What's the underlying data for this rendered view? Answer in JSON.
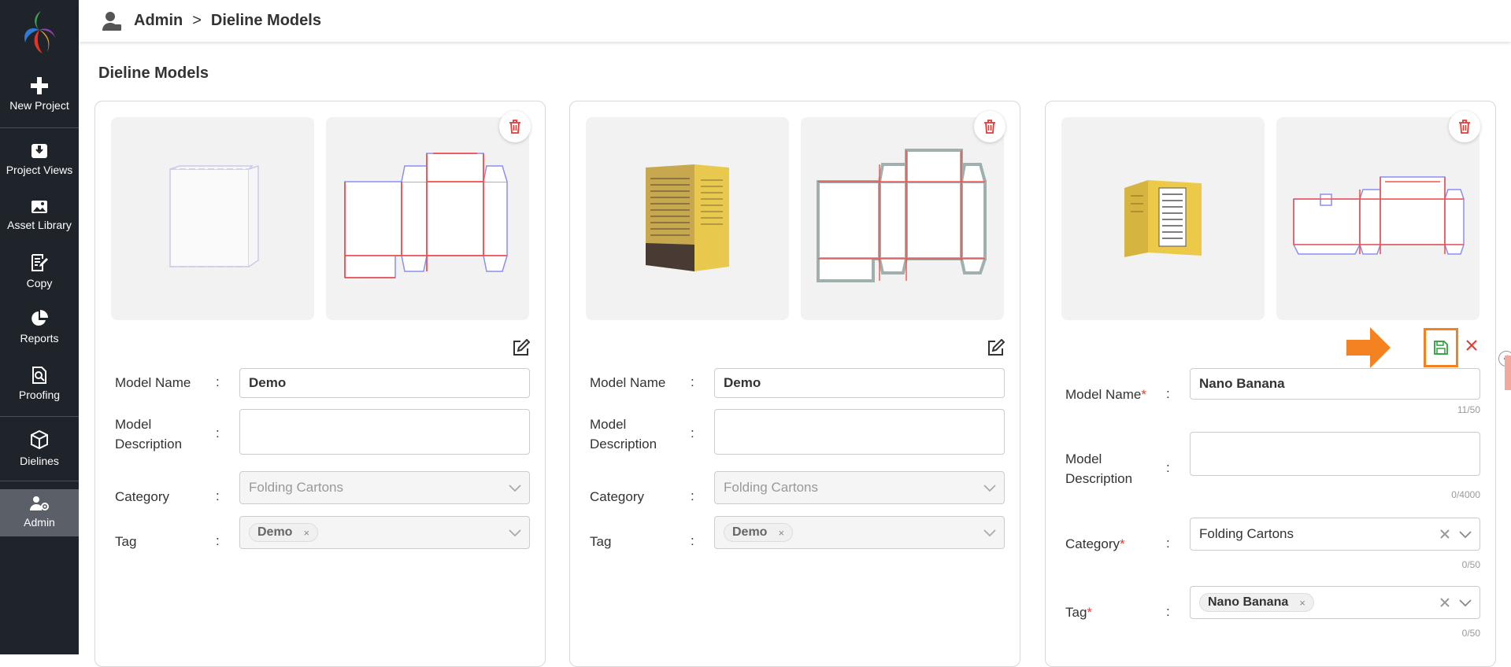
{
  "nav": {
    "items": [
      {
        "label": "New Project",
        "icon": "plus-icon"
      },
      {
        "label": "Project Views",
        "icon": "inbox-icon"
      },
      {
        "label": "Asset Library",
        "icon": "image-icon"
      },
      {
        "label": "Copy",
        "icon": "edit-doc-icon"
      },
      {
        "label": "Reports",
        "icon": "pie-chart-icon"
      },
      {
        "label": "Proofing",
        "icon": "search-doc-icon"
      },
      {
        "label": "Dielines",
        "icon": "box-icon"
      },
      {
        "label": "Admin",
        "icon": "user-gear-icon",
        "active": true
      }
    ]
  },
  "breadcrumb": {
    "root": "Admin",
    "separator": ">",
    "current": "Dieline Models"
  },
  "page": {
    "title": "Dieline Models"
  },
  "labels": {
    "model_name": "Model Name",
    "model_desc_1": "Model",
    "model_desc_2": "Description",
    "category": "Category",
    "tag": "Tag",
    "colon": ":",
    "required_mark": "*"
  },
  "cards": [
    {
      "model_name": "Demo",
      "description": "",
      "category": "Folding Cartons",
      "tag": "Demo",
      "tag_remove": "×"
    },
    {
      "model_name": "Demo",
      "description": "",
      "category": "Folding Cartons",
      "tag": "Demo",
      "tag_remove": "×"
    },
    {
      "model_name": "Nano Banana",
      "description": "",
      "category": "Folding Cartons",
      "tag": "Nano Banana",
      "tag_remove": "×",
      "counts": {
        "name": "11/50",
        "desc": "0/4000",
        "category": "0/50",
        "tag": "0/50"
      }
    }
  ],
  "colors": {
    "sidebar": "#1f242b",
    "accent_orange": "#f58220",
    "delete_red": "#e53935",
    "save_green": "#2e9e3e"
  }
}
